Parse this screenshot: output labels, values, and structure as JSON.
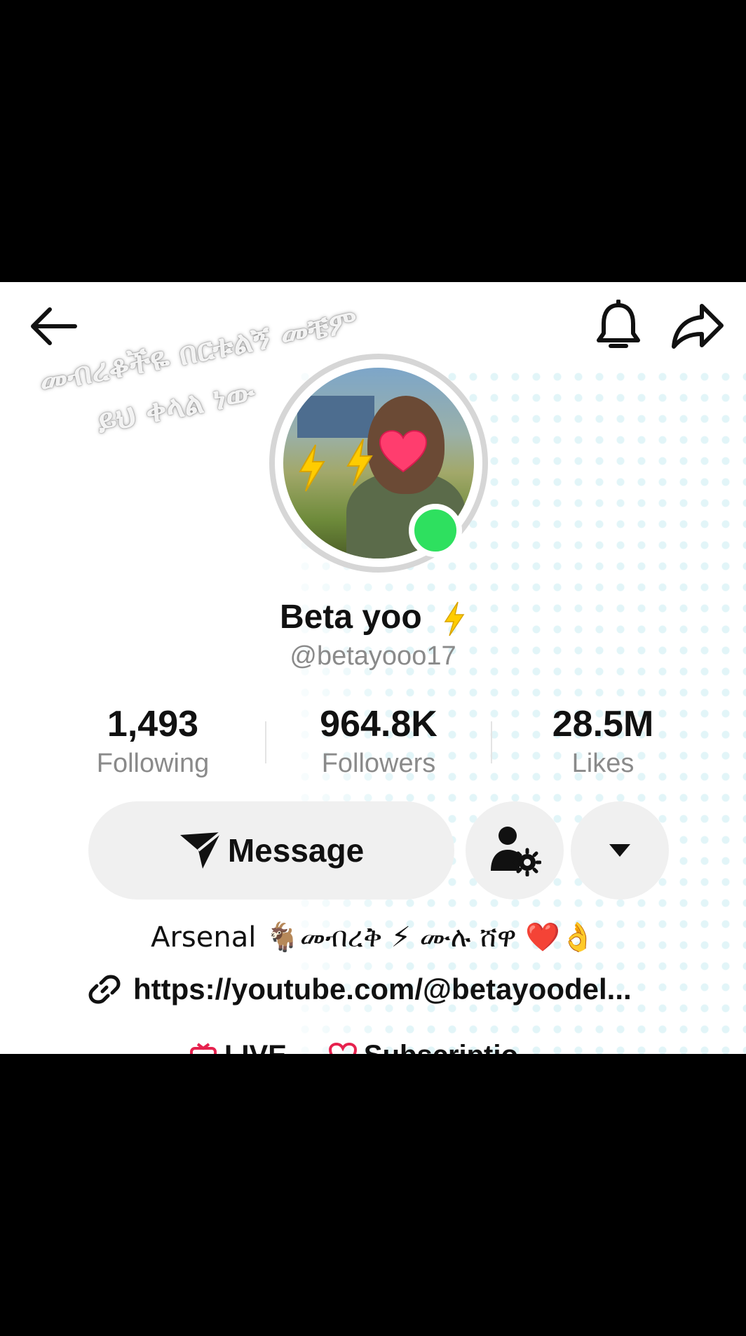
{
  "header": {
    "back_icon": "back-arrow-icon",
    "bell_icon": "bell-icon",
    "share_icon": "share-arrow-icon"
  },
  "profile": {
    "avatar_overlay_line1": "መብረቆችዬ በርቱልኝ መቼም",
    "avatar_overlay_line2": "ይህ ቀላል ነው",
    "display_name": "Beta yoo",
    "handle": "@betayooo17",
    "online": true
  },
  "stats": [
    {
      "value": "1,493",
      "label": "Following"
    },
    {
      "value": "964.8K",
      "label": "Followers"
    },
    {
      "value": "28.5M",
      "label": "Likes"
    }
  ],
  "actions": {
    "message_label": "Message",
    "message_icon": "send-icon",
    "add_friend_icon": "person-settings-icon",
    "more_icon": "chevron-down-icon"
  },
  "bio": {
    "text": "Arsenal 🐐መብረቅ ⚡ ሙሉ ሸዋ ❤️👌",
    "link": "https://youtube.com/@betayoodel...",
    "link_icon": "link-icon"
  },
  "tabs_peek": {
    "live": "LIVE",
    "subscription": "Subscriptio"
  },
  "colors": {
    "online_green": "#2ee05f",
    "button_bg": "#f0f0f0",
    "muted_text": "#8a8a8a",
    "dot_pattern": "#dff4f7"
  }
}
